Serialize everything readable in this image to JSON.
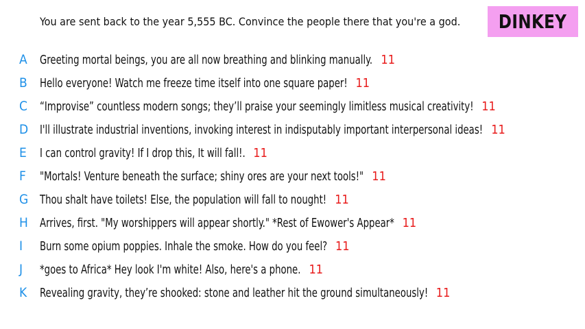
{
  "prompt": "You are sent back to the year 5,555 BC. Convince the people there that you're a god.",
  "player_name": "DINKEY",
  "colors": {
    "letter": "#1e90e8",
    "score": "#e81b1b",
    "badge": "#f49ff0"
  },
  "answers": [
    {
      "letter": "A",
      "text": "Greeting mortal beings, you are all now breathing and blinking manually.",
      "score": "11"
    },
    {
      "letter": "B",
      "text": "Hello everyone! Watch me freeze time itself into one square paper!",
      "score": "11"
    },
    {
      "letter": "C",
      "text": "“Improvise” countless modern songs; they’ll praise your seemingly limitless musical creativity!",
      "score": "11"
    },
    {
      "letter": "D",
      "text": "I'll illustrate industrial inventions, invoking interest in indisputably important interpersonal ideas!",
      "score": "11"
    },
    {
      "letter": "E",
      "text": "I can control gravity! If I drop this, It will fall!.",
      "score": "11"
    },
    {
      "letter": "F",
      "text": "\"Mortals! Venture beneath the surface; shiny ores are your next tools!\"",
      "score": "11"
    },
    {
      "letter": "G",
      "text": "Thou shalt have toilets! Else, the population will fall to nought!",
      "score": "11"
    },
    {
      "letter": "H",
      "text": "Arrives, first. \"My worshippers will appear shortly.\" *Rest of Ewower's Appear*",
      "score": "11"
    },
    {
      "letter": "I",
      "text": "Burn some opium poppies. Inhale the smoke. How do you feel?",
      "score": "11"
    },
    {
      "letter": "J",
      "text": "*goes to Africa* Hey look I'm white! Also, here's a phone.",
      "score": "11"
    },
    {
      "letter": "K",
      "text": "Revealing gravity, they’re shooked: stone and leather hit the ground simultaneously!",
      "score": "11"
    }
  ]
}
